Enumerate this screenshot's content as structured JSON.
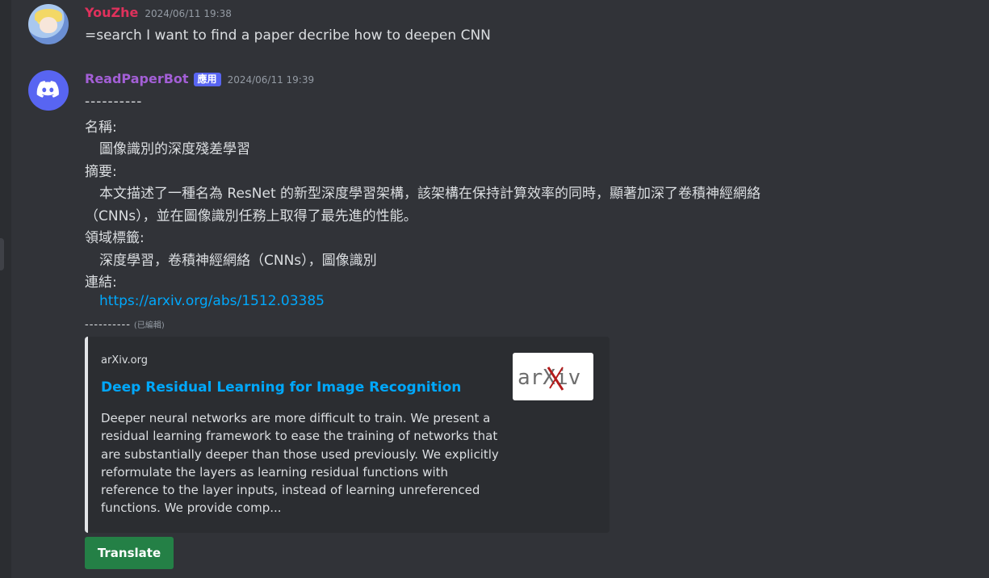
{
  "messages": [
    {
      "username": "YouZhe",
      "timestamp": "2024/06/11 19:38",
      "text": "=search I want to find a paper decribe how to deepen CNN",
      "avatar": "anime-avatar"
    },
    {
      "username": "ReadPaperBot",
      "badge": "應用",
      "timestamp": "2024/06/11 19:39",
      "avatar": "discord-logo-icon",
      "lines": {
        "separator": "----------",
        "name_label": "名稱:",
        "name_value": "圖像識別的深度殘差學習",
        "abstract_label": "摘要:",
        "abstract_line1": "本文描述了一種名為 ResNet 的新型深度學習架構，該架構在保持計算效率的同時，顯著加深了卷積神經網絡",
        "abstract_line2": "（CNNs），並在圖像識別任務上取得了最先進的性能。",
        "tags_label": "領域標籤:",
        "tags_value": "深度學習，卷積神經網絡（CNNs），圖像識別",
        "link_label": "連結:",
        "link_url": "https://arxiv.org/abs/1512.03385",
        "separator_end": "----------",
        "edited": "(已編輯)"
      },
      "embed": {
        "provider": "arXiv.org",
        "title": "Deep Residual Learning for Image Recognition",
        "description": "Deeper neural networks are more difficult to train. We present a residual learning framework to ease the training of networks that are substantially deeper than those used previously. We explicitly reformulate the layers as learning residual functions with reference to the layer inputs, instead of learning unreferenced functions. We provide comp...",
        "thumbnail_text": "arXiv",
        "thumbnail": "arxiv-logo-icon"
      },
      "button": {
        "label": "Translate"
      }
    }
  ],
  "colors": {
    "background": "#313338",
    "user1_name": "#e0315c",
    "bot_name": "#a35fd6",
    "link": "#00a8fc",
    "badge": "#5865f2",
    "button": "#248046"
  }
}
